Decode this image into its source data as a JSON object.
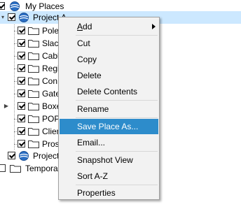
{
  "tree": {
    "my_places": "My Places",
    "project_a": "Project A",
    "children": [
      {
        "label": "Pole",
        "checked": true
      },
      {
        "label": "Slacl",
        "checked": true
      },
      {
        "label": "Cabl",
        "checked": true
      },
      {
        "label": "Regi",
        "checked": true
      },
      {
        "label": "Con",
        "checked": true
      },
      {
        "label": "Gate",
        "checked": true
      },
      {
        "label": "Boxe",
        "checked": true
      },
      {
        "label": "POP",
        "checked": true
      },
      {
        "label": "Clien",
        "checked": true
      },
      {
        "label": "Pros",
        "checked": true
      }
    ],
    "project_b": "Project",
    "temporary": "Tempora"
  },
  "context_menu": {
    "add_prefix": "A",
    "add_rest": "dd",
    "cut": "Cut",
    "copy": "Copy",
    "delete": "Delete",
    "delete_contents": "Delete Contents",
    "rename": "Rename",
    "save_place_as": "Save Place As...",
    "email": "Email...",
    "snapshot_view": "Snapshot View",
    "sort_az": "Sort A-Z",
    "properties": "Properties"
  },
  "colors": {
    "selection": "#cce8ff",
    "menu_highlight": "#2d8ccb",
    "menu_background": "#f2f2f2"
  }
}
